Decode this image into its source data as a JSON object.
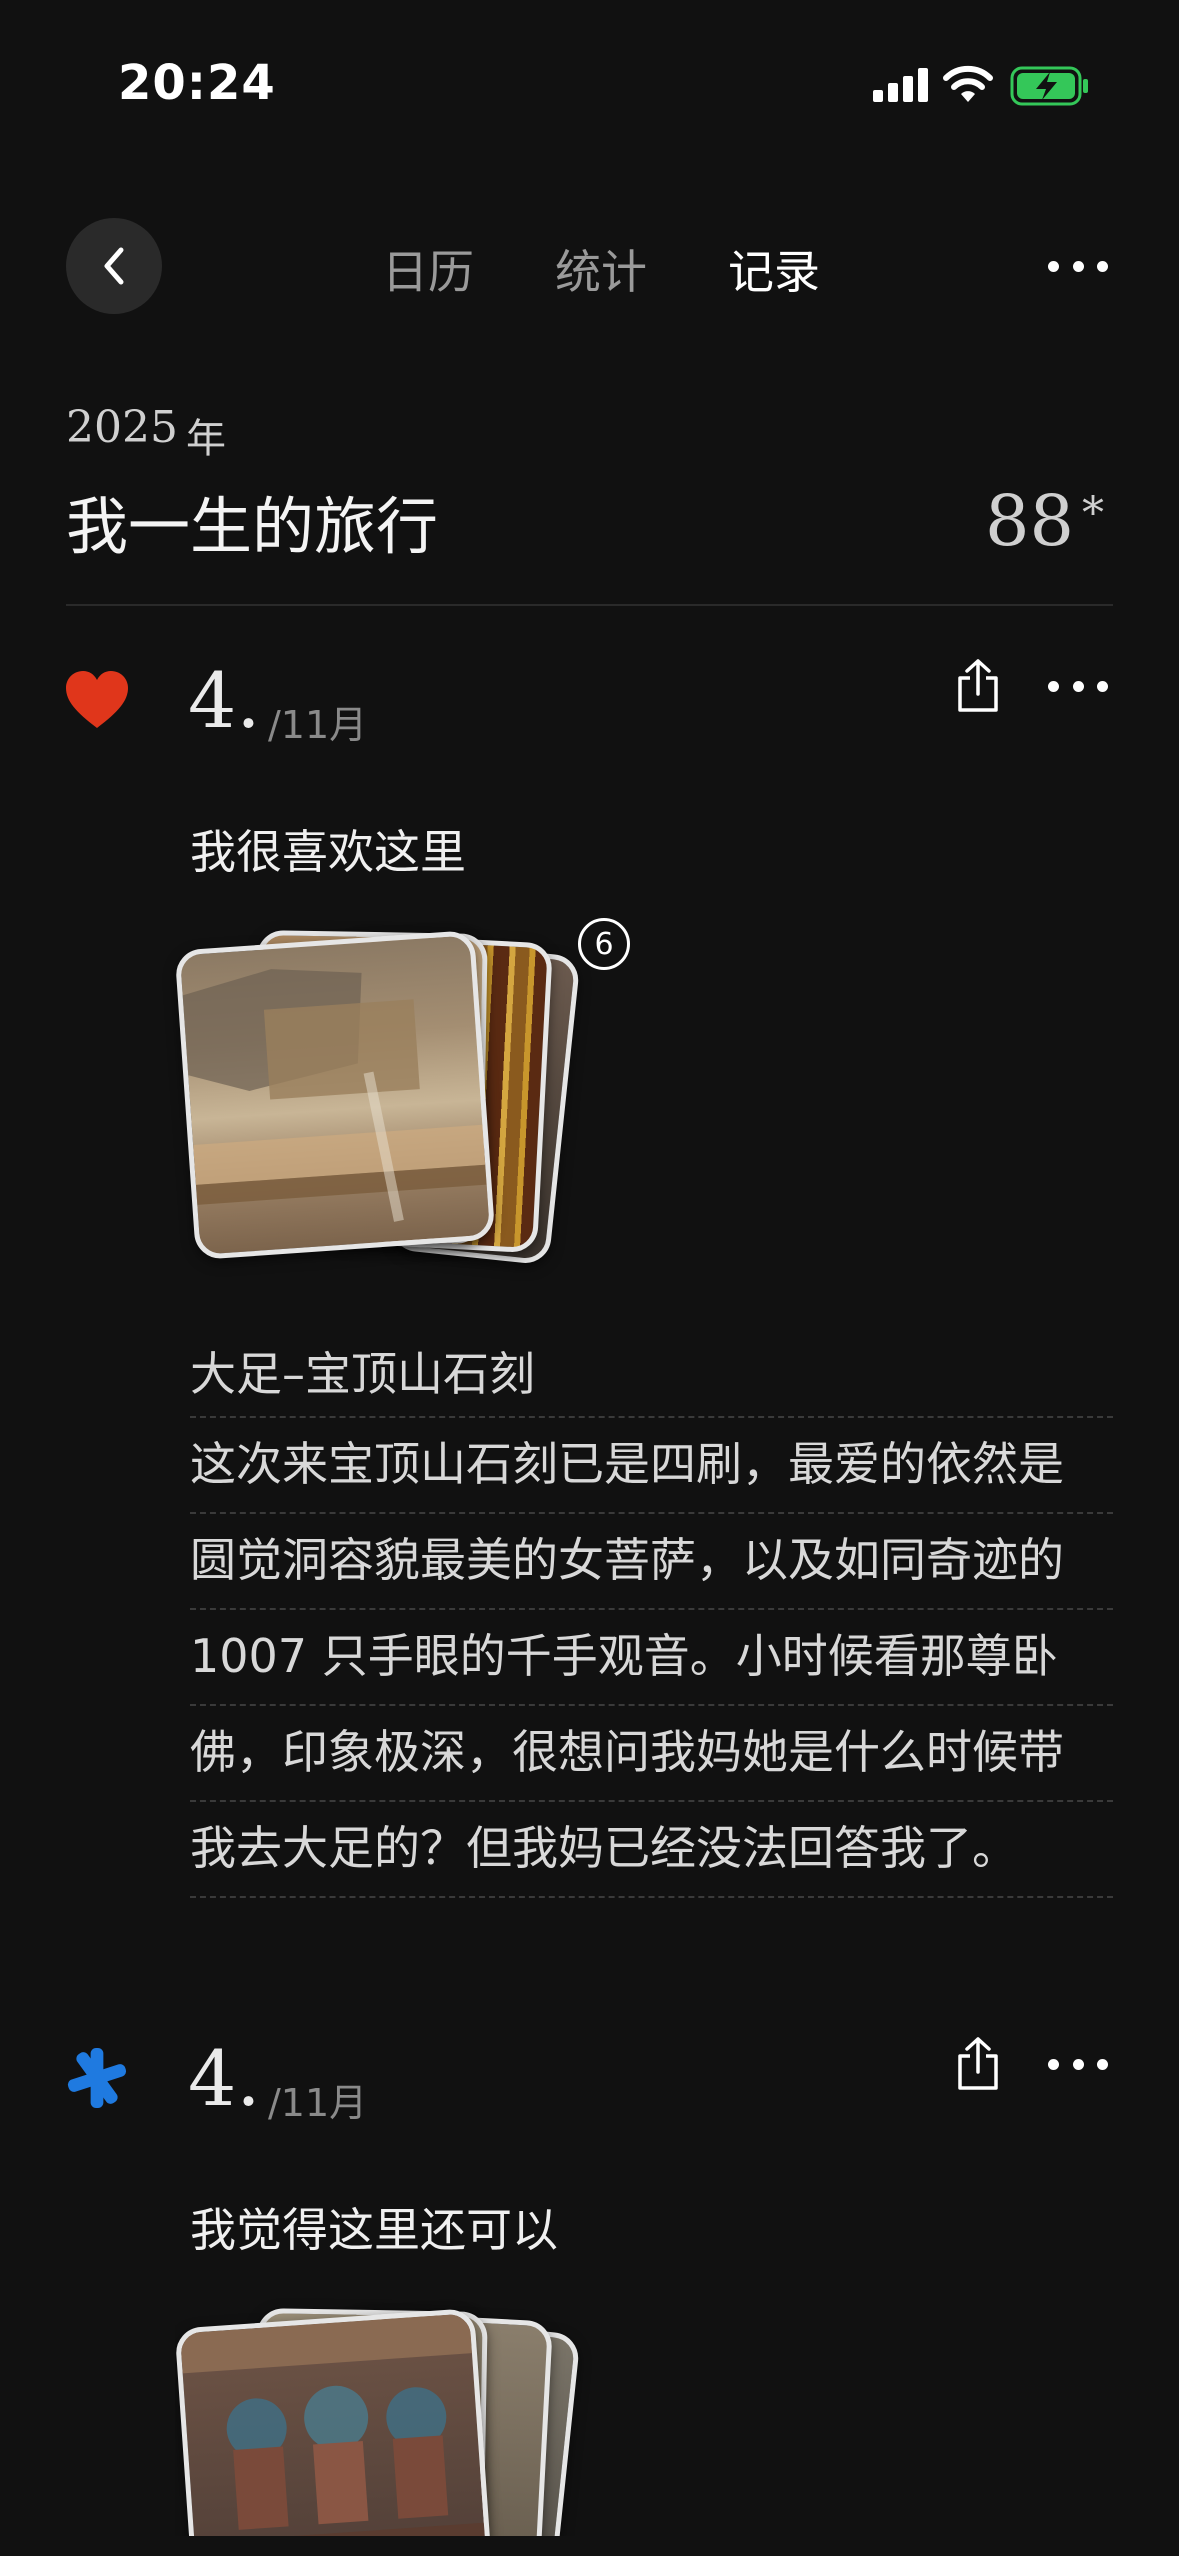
{
  "status_bar": {
    "time": "20:24"
  },
  "nav": {
    "tabs": [
      {
        "label": "日历",
        "active": false
      },
      {
        "label": "统计",
        "active": false
      },
      {
        "label": "记录",
        "active": true
      }
    ]
  },
  "header": {
    "year": "2025",
    "year_suffix": "年",
    "title": "我一生的旅行",
    "count": "88",
    "count_mark": "*"
  },
  "entries": [
    {
      "icon": "heart-icon",
      "icon_color": "#e0361b",
      "day": "4.",
      "month": "/11月",
      "title": "我很喜欢这里",
      "photo_count": "6",
      "location": "大足–宝顶山石刻",
      "note_lines": [
        "这次来宝顶山石刻已是四刷，最爱的依然是",
        "圆觉洞容貌最美的女菩萨，以及如同奇迹的",
        "1007 只手眼的千手观音。小时候看那尊卧",
        "佛，印象极深，很想问我妈她是什么时候带",
        "我去大足的？但我妈已经没法回答我了。"
      ]
    },
    {
      "icon": "asterisk-icon",
      "icon_color": "#1f7ae0",
      "day": "4.",
      "month": "/11月",
      "title": "我觉得这里还可以"
    }
  ]
}
